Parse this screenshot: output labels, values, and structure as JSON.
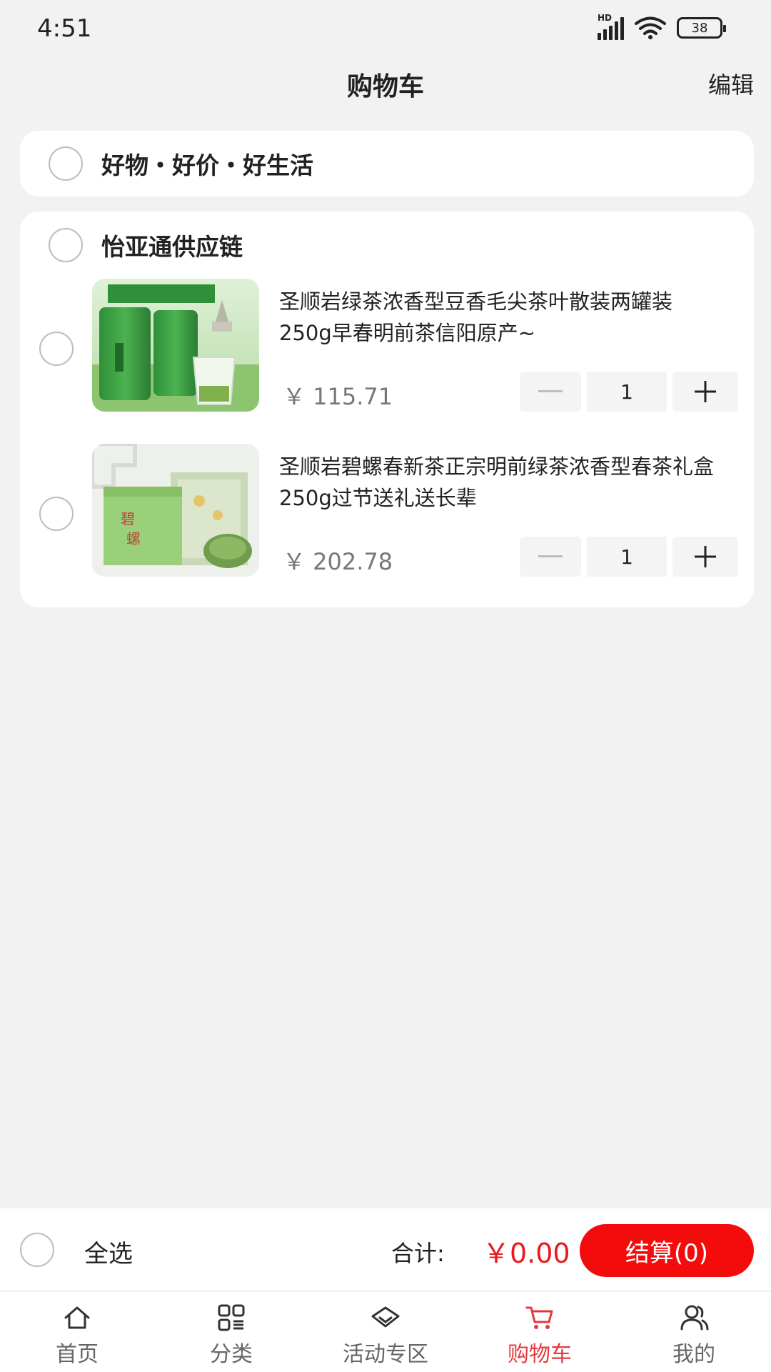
{
  "status_bar": {
    "time": "4:51",
    "network": "HD",
    "battery": "38"
  },
  "header": {
    "title": "购物车",
    "edit_label": "编辑"
  },
  "promo_group": {
    "name": "好物・好价・好生活"
  },
  "shop_group": {
    "name": "怡亚通供应链",
    "items": [
      {
        "title": "圣顺岩绿茶浓香型豆香毛尖茶叶散装两罐装250g早春明前茶信阳原产~",
        "price": "￥ 115.71",
        "quantity": "1",
        "image": "maojian-tea-tins-image"
      },
      {
        "title": "圣顺岩碧螺春新茶正宗明前绿茶浓香型春茶礼盒250g过节送礼送长辈",
        "price": "￥ 202.78",
        "quantity": "1",
        "image": "biluochun-gift-box-image"
      }
    ]
  },
  "checkout": {
    "select_all_label": "全选",
    "total_label": "合计:",
    "total_value": "￥0.00",
    "button_label": "结算(0)"
  },
  "tabs": [
    {
      "label": "首页",
      "icon": "home-icon"
    },
    {
      "label": "分类",
      "icon": "category-icon"
    },
    {
      "label": "活动专区",
      "icon": "activity-icon"
    },
    {
      "label": "购物车",
      "icon": "cart-icon",
      "active": true
    },
    {
      "label": "我的",
      "icon": "profile-icon"
    }
  ],
  "colors": {
    "accent": "#e4393c",
    "checkout_button": "#f40b0b",
    "price": "#777777"
  }
}
